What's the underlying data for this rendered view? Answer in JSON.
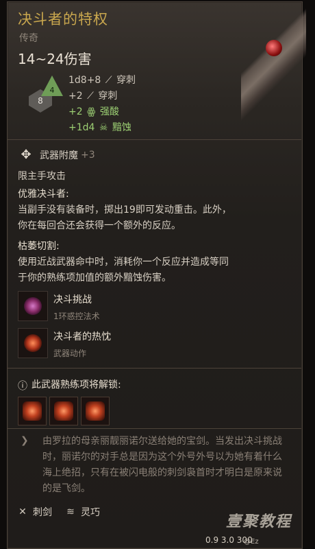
{
  "item": {
    "title": "决斗者的特权",
    "rarity": "传奇",
    "damage": "14~24伤害",
    "dice": {
      "d4": "4",
      "d8": "8"
    },
    "stats": [
      {
        "text": "1d8+8",
        "icon": "sword-icon",
        "glyph": "⟋",
        "type": "穿刺",
        "color": "#cfc7bb"
      },
      {
        "text": "+2",
        "icon": "sword-icon",
        "glyph": "⟋",
        "type": "穿刺",
        "color": "#cfc7bb"
      },
      {
        "text": "+2",
        "icon": "acid-icon",
        "glyph": "ꙮ",
        "type": "强酸",
        "color": "#9ccf73"
      },
      {
        "text": "+1d4",
        "icon": "necrotic-icon",
        "glyph": "☠",
        "type": "黯蚀",
        "color": "#9ccf73"
      }
    ],
    "enchant": {
      "label": "武器附魔",
      "value": "+3"
    },
    "main_hand_only": "限主手攻击",
    "passive1": {
      "title": "优雅决斗者:",
      "lines": [
        "当副手没有装备时，掷出19即可发动重击。此外，",
        "你在每回合还会获得一个额外的反应。"
      ]
    },
    "passive2": {
      "title": "枯萎切割:",
      "lines": [
        "使用近战武器命中时，消耗你一个反应并造成等同",
        "于你的熟练项加值的额外黯蚀伤害。"
      ]
    },
    "skills": [
      {
        "name": "决斗挑战",
        "sub": "1环惑控法术"
      },
      {
        "name": "决斗者的热忱",
        "sub": "武器动作"
      }
    ],
    "unlock": "此武器熟练项将解锁:",
    "lore": "由罗拉的母亲丽靓丽诺尔送给她的宝剑。当发出决斗挑战时，丽诺尔的对手总是因为这个外号外号以为她有着什么海上绝招，只有在被闪电般的刺剑袅首时才明白是原来说的是飞剑。",
    "footer": [
      {
        "icon": "rapier-icon",
        "glyph": "✕",
        "label": "刺剑"
      },
      {
        "icon": "finesse-icon",
        "glyph": "≋",
        "label": "灵巧"
      }
    ],
    "bottom": "0.9    3.0    300",
    "watermark": "壹聚教程",
    "watermark_sub": "@Ez"
  }
}
